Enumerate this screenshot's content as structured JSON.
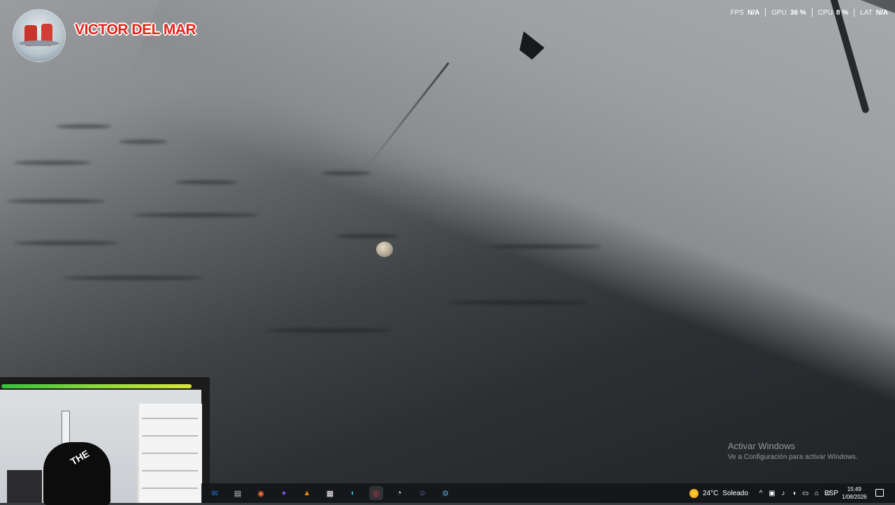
{
  "channel": {
    "name": "VICTOR DEL MAR"
  },
  "performance": {
    "fps": {
      "label": "FPS",
      "value": "N/A"
    },
    "gpu": {
      "label": "GPU",
      "value": "36 %"
    },
    "cpu": {
      "label": "CPU",
      "value": "8 %"
    },
    "lat": {
      "label": "LAT",
      "value": "N/A"
    }
  },
  "webcam": {
    "shirt_text": "THE",
    "audio_bar_color": "#8bd83b"
  },
  "activation": {
    "title": "Activar Windows",
    "subtitle": "Ve a Configuración para activar Windows."
  },
  "taskbar": {
    "apps": [
      {
        "name": "outlook-icon",
        "glyph": "✉",
        "color": "#1a73d9"
      },
      {
        "name": "file-explorer-icon",
        "glyph": "▤",
        "color": "#c9c9c9"
      },
      {
        "name": "firefox-icon",
        "glyph": "◉",
        "color": "#ff7139"
      },
      {
        "name": "copilot-icon",
        "glyph": "✦",
        "color": "#7b5cff"
      },
      {
        "name": "vlc-icon",
        "glyph": "▲",
        "color": "#f08a00"
      },
      {
        "name": "microsoft-store-icon",
        "glyph": "▦",
        "color": "#ffffff"
      },
      {
        "name": "edge-icon",
        "glyph": "◐",
        "color": "#2fb7d6"
      },
      {
        "name": "obs-record-icon",
        "glyph": "◎",
        "color": "#e0314b"
      },
      {
        "name": "speedometer-icon",
        "glyph": "◔",
        "color": "#ffffff"
      },
      {
        "name": "discord-icon",
        "glyph": "☺",
        "color": "#6b6cf2"
      },
      {
        "name": "steam-icon",
        "glyph": "⚙",
        "color": "#5aa8dc"
      }
    ],
    "weather": {
      "temp": "24°C",
      "condition": "Soleado"
    },
    "tray_icons": [
      "chevron-up-icon",
      "camera-icon",
      "microphone-icon",
      "volume-icon",
      "display-icon",
      "network-icon",
      "speaker-icon"
    ],
    "language": "ESP",
    "time": "15:49",
    "date": "1/08/2026"
  }
}
